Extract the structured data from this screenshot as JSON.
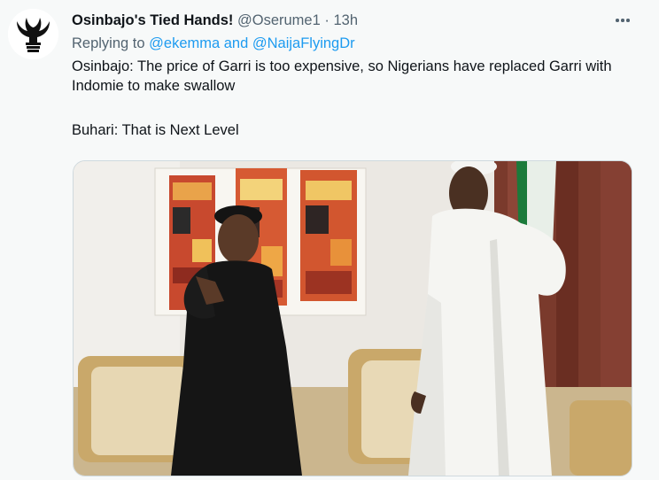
{
  "tweet": {
    "display_name": "Osinbajo's Tied Hands!",
    "handle": "@Oserume1",
    "separator": "·",
    "time": "13h",
    "replying_prefix": "Replying to",
    "replying_to": "@ekemma and @NaijaFlyingDr",
    "text_line1": "Osinbajo: The price of Garri is too expensive, so Nigerians have replaced Garri with Indomie to make swallow",
    "text_line2": "Buhari: That is Next Level"
  },
  "icons": {
    "avatar": "hands-logo-icon",
    "more": "more-options-icon"
  },
  "colors": {
    "background": "#f7f9f9",
    "link": "#1d9bf0",
    "secondary_text": "#536471",
    "primary_text": "#0f1419"
  }
}
